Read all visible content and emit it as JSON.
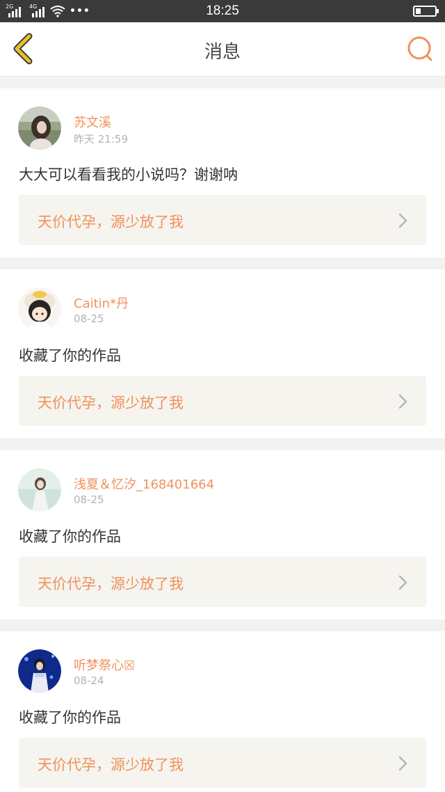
{
  "status_bar": {
    "net_1": "2G",
    "net_2": "4G",
    "dots": "•••",
    "time": "18:25"
  },
  "header": {
    "title": "消息"
  },
  "messages": [
    {
      "username": "苏文溪",
      "time": "昨天 21:59",
      "content": "大大可以看看我的小说吗？谢谢呐",
      "work_title": "天价代孕，源少放了我"
    },
    {
      "username": "Caitin*丹",
      "time": "08-25",
      "content": "收藏了你的作品",
      "work_title": "天价代孕，源少放了我"
    },
    {
      "username": "浅夏＆忆汐_168401664",
      "time": "08-25",
      "content": "收藏了你的作品",
      "work_title": "天价代孕，源少放了我"
    },
    {
      "username": "听梦祭心☒",
      "time": "08-24",
      "content": "收藏了你的作品",
      "work_title": "天价代孕，源少放了我"
    }
  ],
  "colors": {
    "accent": "#f0915a",
    "back_icon": "#e8c12a",
    "card_link_bg": "#f5f4ef",
    "page_bg": "#f2f2f2"
  },
  "icons": {
    "back": "chevron-left-icon",
    "search": "search-icon",
    "row_arrow": "chevron-right-icon"
  }
}
